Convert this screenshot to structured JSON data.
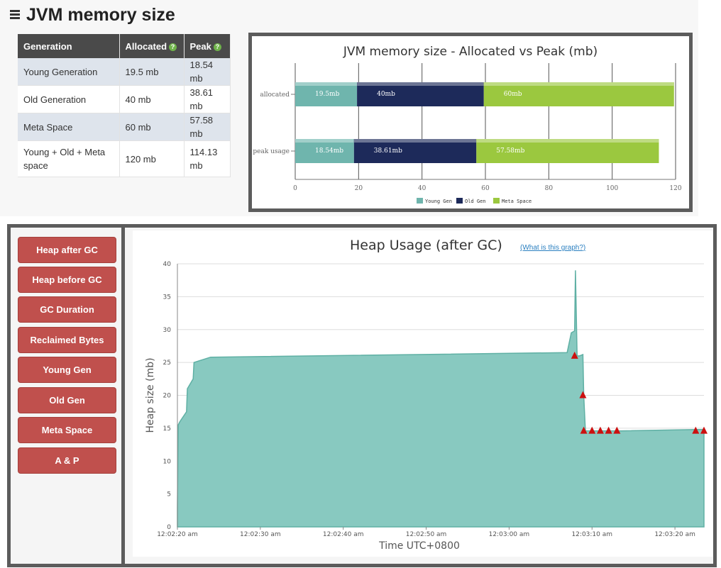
{
  "page_title": "JVM memory size",
  "memory_table": {
    "headers": [
      "Generation",
      "Allocated",
      "Peak"
    ],
    "rows": [
      [
        "Young Generation",
        "19.5 mb",
        "18.54 mb"
      ],
      [
        "Old Generation",
        "40 mb",
        "38.61 mb"
      ],
      [
        "Meta Space",
        "60 mb",
        "57.58 mb"
      ],
      [
        "Young + Old + Meta space",
        "120 mb",
        "114.13 mb"
      ]
    ]
  },
  "nav_buttons": [
    "Heap after GC",
    "Heap before GC",
    "GC Duration",
    "Reclaimed Bytes",
    "Young Gen",
    "Old Gen",
    "Meta Space",
    "A & P"
  ],
  "heap_header": {
    "title": "Heap Usage (after GC)",
    "link": "(What is this graph?)"
  },
  "colors": {
    "young": "#6fb5ad",
    "old": "#1d2a5a",
    "meta": "#9bc83f",
    "heap_fill": "#88c9c0",
    "heap_line": "#5fb0a4",
    "marker": "#cc1010",
    "button": "#c0504d"
  },
  "chart_data": [
    {
      "type": "bar",
      "orientation": "horizontal-stacked",
      "title": "JVM memory size - Allocated vs Peak (mb)",
      "categories": [
        "allocated",
        "peak usage"
      ],
      "series": [
        {
          "name": "Young Gen",
          "values": [
            19.5,
            18.54
          ],
          "labels": [
            "19.5mb",
            "18.54mb"
          ]
        },
        {
          "name": "Old Gen",
          "values": [
            40,
            38.61
          ],
          "labels": [
            "40mb",
            "38.61mb"
          ]
        },
        {
          "name": "Meta Space",
          "values": [
            60,
            57.58
          ],
          "labels": [
            "60mb",
            "57.58mb"
          ]
        }
      ],
      "xlim": [
        0,
        120
      ],
      "xticks": [
        0,
        20,
        40,
        60,
        80,
        100,
        120
      ],
      "legend": "bottom-center"
    },
    {
      "type": "area",
      "title": "Heap Usage (after GC)",
      "xlabel": "Time UTC+0800",
      "ylabel": "Heap size (mb)",
      "ylim": [
        0,
        40
      ],
      "yticks": [
        0,
        5,
        10,
        15,
        20,
        25,
        30,
        35,
        40
      ],
      "xticks": [
        "12:02:20 am",
        "12:02:30 am",
        "12:02:40 am",
        "12:02:50 am",
        "12:03:00 am",
        "12:03:10 am",
        "12:03:20 am"
      ],
      "xlim_seconds": [
        0,
        63.5
      ],
      "series": [
        {
          "name": "Heap after GC",
          "x_seconds": [
            0,
            0.1,
            0.3,
            1.1,
            1.2,
            1.9,
            2.0,
            4.0,
            47.0,
            47.5,
            47.9,
            48.0,
            48.2,
            48.3,
            48.5,
            48.9,
            49.0,
            49.2,
            49.5,
            50.5,
            51.5,
            52.5,
            53.5,
            62.5,
            63.5
          ],
          "y": [
            3.0,
            15.5,
            16.0,
            17.5,
            21.0,
            22.5,
            25.0,
            25.8,
            26.5,
            29.5,
            29.8,
            39.0,
            26.0,
            26.0,
            26.0,
            26.2,
            20.0,
            14.6,
            14.6,
            14.6,
            14.6,
            14.6,
            14.6,
            14.8,
            14.8
          ]
        }
      ],
      "markers": [
        {
          "x_seconds": 47.9,
          "y": 26.0
        },
        {
          "x_seconds": 48.9,
          "y": 20.0
        },
        {
          "x_seconds": 49.0,
          "y": 14.6
        },
        {
          "x_seconds": 50.0,
          "y": 14.6
        },
        {
          "x_seconds": 51.0,
          "y": 14.6
        },
        {
          "x_seconds": 52.0,
          "y": 14.6
        },
        {
          "x_seconds": 53.0,
          "y": 14.6
        },
        {
          "x_seconds": 62.5,
          "y": 14.6
        },
        {
          "x_seconds": 63.5,
          "y": 14.6
        }
      ]
    }
  ]
}
